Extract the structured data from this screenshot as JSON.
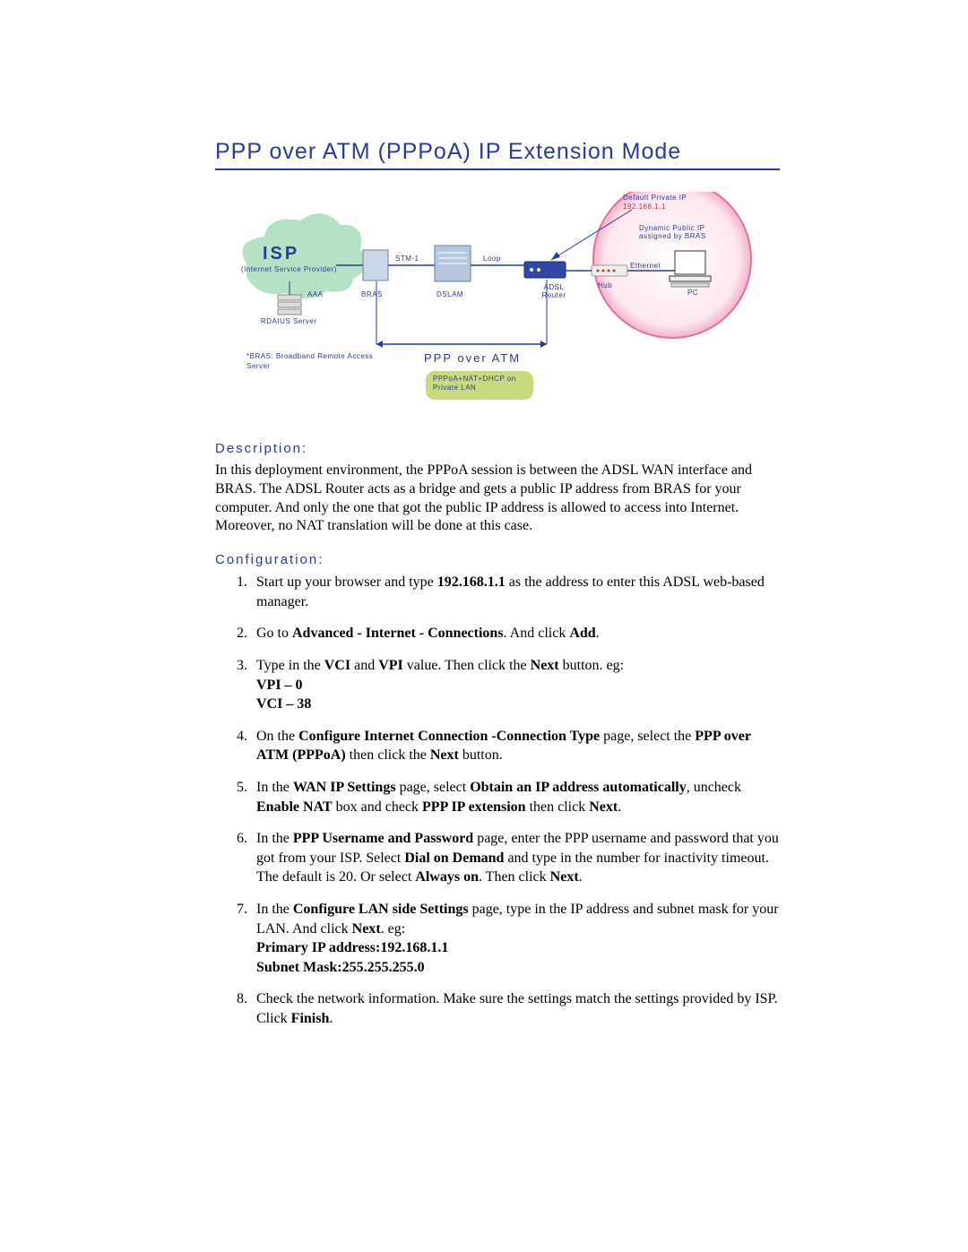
{
  "title": "PPP over ATM (PPPoA) IP Extension Mode",
  "diagram": {
    "isp": "ISP",
    "isp_sub": "(Internet Service Provider)",
    "stm1": "STM-1",
    "loop": "Loop",
    "bras": "BRAS",
    "dslam": "DSLAM",
    "adsl_router": "ADSL Router",
    "aaa": "AAA",
    "radius": "RDAIUS Server",
    "hub": "Hub",
    "ethernet": "Ethernet",
    "pc": "PC",
    "default_ip_label": "Default Private IP",
    "default_ip_value": "192.168.1.1",
    "dynamic_ip": "Dynamic Public IP assigned by BRAS",
    "ppp_atm": "PPP over ATM",
    "pppoa_note": "PPPoA+NAT+DHCP on Private LAN",
    "bras_note": "*BRAS: Broadband Remote Access Server"
  },
  "sections": {
    "description_label": "Description:",
    "description_text": "In this deployment environment, the PPPoA session is between the ADSL WAN interface and BRAS. The ADSL Router acts as a bridge and gets a public IP address from BRAS for your computer. And only the one that got the public IP address is allowed to access into Internet. Moreover, no NAT translation will be done at this case.",
    "configuration_label": "Configuration:",
    "steps": [
      {
        "pre": "Start up your browser and type ",
        "b1": "192.168.1.1",
        "post": " as the address to enter this ADSL web-based manager."
      },
      {
        "pre": "Go to ",
        "b1": "Advanced - Internet - Connections",
        "mid1": ". And click ",
        "b2": "Add",
        "post": "."
      },
      {
        "pre": "Type in the ",
        "b1": "VCI",
        "mid1": " and ",
        "b2": "VPI",
        "mid2": " value. Then click the ",
        "b3": "Next",
        "post": " button. eg:",
        "extra_b1": "VPI – 0",
        "extra_b2": "VCI – 38"
      },
      {
        "pre": "On the ",
        "b1": "Configure Internet Connection -Connection Type",
        "mid1": " page, select the ",
        "b2": "PPP over ATM (PPPoA)",
        "mid2": " then click the ",
        "b3": "Next",
        "post": " button."
      },
      {
        "pre": "In the ",
        "b1": "WAN IP Settings",
        "mid1": " page, select ",
        "b2": "Obtain an IP address automatically",
        "mid2": ", uncheck ",
        "b3": "Enable NAT",
        "mid3": " box and check ",
        "b4": "PPP IP extension",
        "mid4": " then click ",
        "b5": "Next",
        "post": "."
      },
      {
        "pre": "In the ",
        "b1": "PPP Username and Password",
        "mid1": " page, enter the PPP username and password that you got from your ISP. Select ",
        "b2": "Dial on Demand",
        "mid2": " and type in the number for inactivity timeout. The default is 20. Or select ",
        "b3": "Always on",
        "mid3": ". Then click ",
        "b4": "Next",
        "post": "."
      },
      {
        "pre": "In the ",
        "b1": "Configure LAN side Settings",
        "mid1": " page, type in the IP address and subnet mask for your LAN. And click ",
        "b2": "Next",
        "post": ". eg:",
        "extra_b1": "Primary IP address:192.168.1.1",
        "extra_b2": "Subnet Mask:255.255.255.0"
      },
      {
        "pre": "Check the network information. Make sure the settings match the settings provided by ISP. Click ",
        "b1": "Finish",
        "post": "."
      }
    ]
  }
}
